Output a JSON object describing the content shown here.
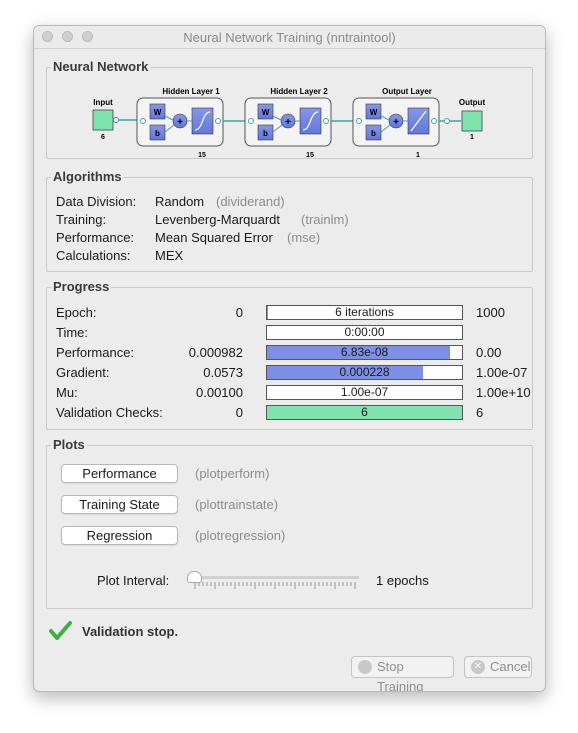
{
  "window": {
    "title": "Neural Network Training (nntraintool)"
  },
  "network": {
    "section_title": "Neural Network",
    "input": {
      "label": "Input",
      "size": "6"
    },
    "layers": [
      {
        "label": "Hidden Layer 1",
        "size": "15",
        "w": "W",
        "b": "b"
      },
      {
        "label": "Hidden Layer 2",
        "size": "15",
        "w": "W",
        "b": "b"
      },
      {
        "label": "Output Layer",
        "size": "1",
        "w": "W",
        "b": "b"
      }
    ],
    "output": {
      "label": "Output",
      "size": "1"
    }
  },
  "algorithms": {
    "section_title": "Algorithms",
    "rows": [
      {
        "label": "Data Division:",
        "value": "Random",
        "fn": "(dividerand)"
      },
      {
        "label": "Training:",
        "value": "Levenberg-Marquardt",
        "fn": "(trainlm)"
      },
      {
        "label": "Performance:",
        "value": "Mean Squared Error",
        "fn": "(mse)"
      },
      {
        "label": "Calculations:",
        "value": "MEX",
        "fn": ""
      }
    ]
  },
  "progress": {
    "section_title": "Progress",
    "rows": [
      {
        "label": "Epoch:",
        "start": "0",
        "bar_text": "6 iterations",
        "fill": 0.006,
        "limit": "1000",
        "color": "#7d8fe6"
      },
      {
        "label": "Time:",
        "start": "",
        "bar_text": "0:00:00",
        "fill": 0,
        "limit": "",
        "color": "#7d8fe6"
      },
      {
        "label": "Performance:",
        "start": "0.000982",
        "bar_text": "6.83e-08",
        "fill": 0.94,
        "limit": "0.00",
        "color": "#7d8fe6"
      },
      {
        "label": "Gradient:",
        "start": "0.0573",
        "bar_text": "0.000228",
        "fill": 0.8,
        "limit": "1.00e-07",
        "color": "#7d8fe6"
      },
      {
        "label": "Mu:",
        "start": "0.00100",
        "bar_text": "1.00e-07",
        "fill": 0,
        "limit": "1.00e+10",
        "color": "#7d8fe6"
      },
      {
        "label": "Validation Checks:",
        "start": "0",
        "bar_text": "6",
        "fill": 1.0,
        "limit": "6",
        "color": "#7ee3ad"
      }
    ]
  },
  "plots": {
    "section_title": "Plots",
    "buttons": [
      {
        "label": "Performance",
        "fn": "(plotperform)"
      },
      {
        "label": "Training State",
        "fn": "(plottrainstate)"
      },
      {
        "label": "Regression",
        "fn": "(plotregression)"
      }
    ],
    "interval_label": "Plot Interval:",
    "interval_value": "1 epochs",
    "interval_fraction": 0.0
  },
  "status": {
    "text": "Validation stop.",
    "icon": "checkmark-icon",
    "color": "#3cb043"
  },
  "footer": {
    "stop_label": "Stop Training",
    "cancel_label": "Cancel"
  }
}
